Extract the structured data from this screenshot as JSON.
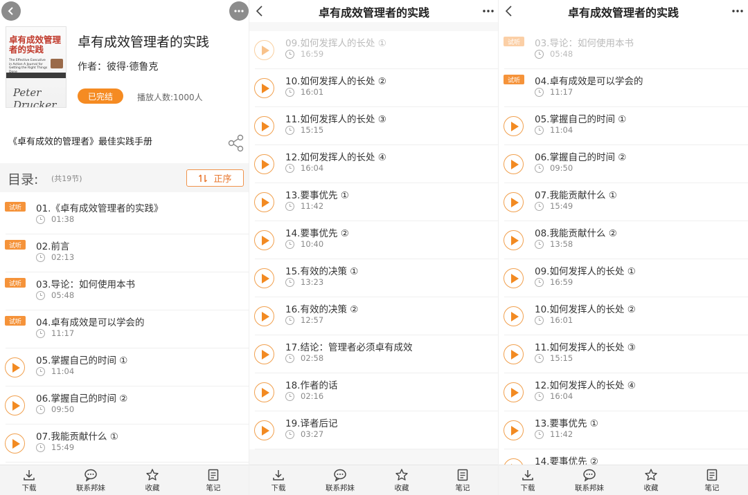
{
  "book": {
    "title": "卓有成效管理者的实践",
    "author_line": "作者：彼得·德鲁克",
    "status": "已完结",
    "play_count": "播放人数:1000人",
    "tagline": "《卓有成效的管理者》最佳实践手册",
    "cover": {
      "title": "卓有成效管理者的实践",
      "subtitle": "The Effective Executive in Action A Journal for Getting the Right Things Done",
      "signature": "Peter Drucker"
    }
  },
  "toc": {
    "title": "目录:",
    "count": "(共19节)",
    "sort_label": "正序"
  },
  "nav": {
    "title": "卓有成效管理者的实践",
    "back_icon": "chevron-left-icon",
    "more_icon": "more-dots-icon"
  },
  "trial_label": "试听",
  "colors": {
    "accent": "#f28a22",
    "badge": "#f5933a"
  },
  "panel_a_episodes": [
    {
      "title": "01.《卓有成效管理者的实践》",
      "duration": "01:38",
      "trial": true
    },
    {
      "title": "02.前言",
      "duration": "02:13",
      "trial": true
    },
    {
      "title": "03.导论：如何使用本书",
      "duration": "05:48",
      "trial": true
    },
    {
      "title": "04.卓有成效是可以学会的",
      "duration": "11:17",
      "trial": true
    },
    {
      "title": "05.掌握自己的时间 ①",
      "duration": "11:04",
      "trial": false
    },
    {
      "title": "06.掌握自己的时间 ②",
      "duration": "09:50",
      "trial": false
    },
    {
      "title": "07.我能贡献什么 ①",
      "duration": "15:49",
      "trial": false
    }
  ],
  "panel_b_episodes": [
    {
      "title": "09.如何发挥人的长处 ①",
      "duration": "16:59",
      "trial": false,
      "dim": true
    },
    {
      "title": "10.如何发挥人的长处 ②",
      "duration": "16:01",
      "trial": false
    },
    {
      "title": "11.如何发挥人的长处 ③",
      "duration": "15:15",
      "trial": false
    },
    {
      "title": "12.如何发挥人的长处 ④",
      "duration": "16:04",
      "trial": false
    },
    {
      "title": "13.要事优先 ①",
      "duration": "11:42",
      "trial": false
    },
    {
      "title": "14.要事优先 ②",
      "duration": "10:40",
      "trial": false
    },
    {
      "title": "15.有效的决策 ①",
      "duration": "13:23",
      "trial": false
    },
    {
      "title": "16.有效的决策 ②",
      "duration": "12:57",
      "trial": false
    },
    {
      "title": "17.结论：管理者必须卓有成效",
      "duration": "02:58",
      "trial": false
    },
    {
      "title": "18.作者的话",
      "duration": "02:16",
      "trial": false
    },
    {
      "title": "19.译者后记",
      "duration": "03:27",
      "trial": false
    }
  ],
  "panel_c_episodes": [
    {
      "title": "03.导论：如何使用本书",
      "duration": "05:48",
      "trial": true,
      "dim": true
    },
    {
      "title": "04.卓有成效是可以学会的",
      "duration": "11:17",
      "trial": true
    },
    {
      "title": "05.掌握自己的时间 ①",
      "duration": "11:04",
      "trial": false
    },
    {
      "title": "06.掌握自己的时间 ②",
      "duration": "09:50",
      "trial": false
    },
    {
      "title": "07.我能贡献什么 ①",
      "duration": "15:49",
      "trial": false
    },
    {
      "title": "08.我能贡献什么 ②",
      "duration": "13:58",
      "trial": false
    },
    {
      "title": "09.如何发挥人的长处 ①",
      "duration": "16:59",
      "trial": false
    },
    {
      "title": "10.如何发挥人的长处 ②",
      "duration": "16:01",
      "trial": false
    },
    {
      "title": "11.如何发挥人的长处 ③",
      "duration": "15:15",
      "trial": false
    },
    {
      "title": "12.如何发挥人的长处 ④",
      "duration": "16:04",
      "trial": false
    },
    {
      "title": "13.要事优先 ①",
      "duration": "11:42",
      "trial": false
    },
    {
      "title": "14.要事优先 ②",
      "duration": "",
      "trial": false
    }
  ],
  "bottom_bar": [
    {
      "label": "下载",
      "icon": "download-icon"
    },
    {
      "label": "联系邦妹",
      "icon": "chat-icon"
    },
    {
      "label": "收藏",
      "icon": "star-icon"
    },
    {
      "label": "笔记",
      "icon": "note-icon"
    }
  ]
}
